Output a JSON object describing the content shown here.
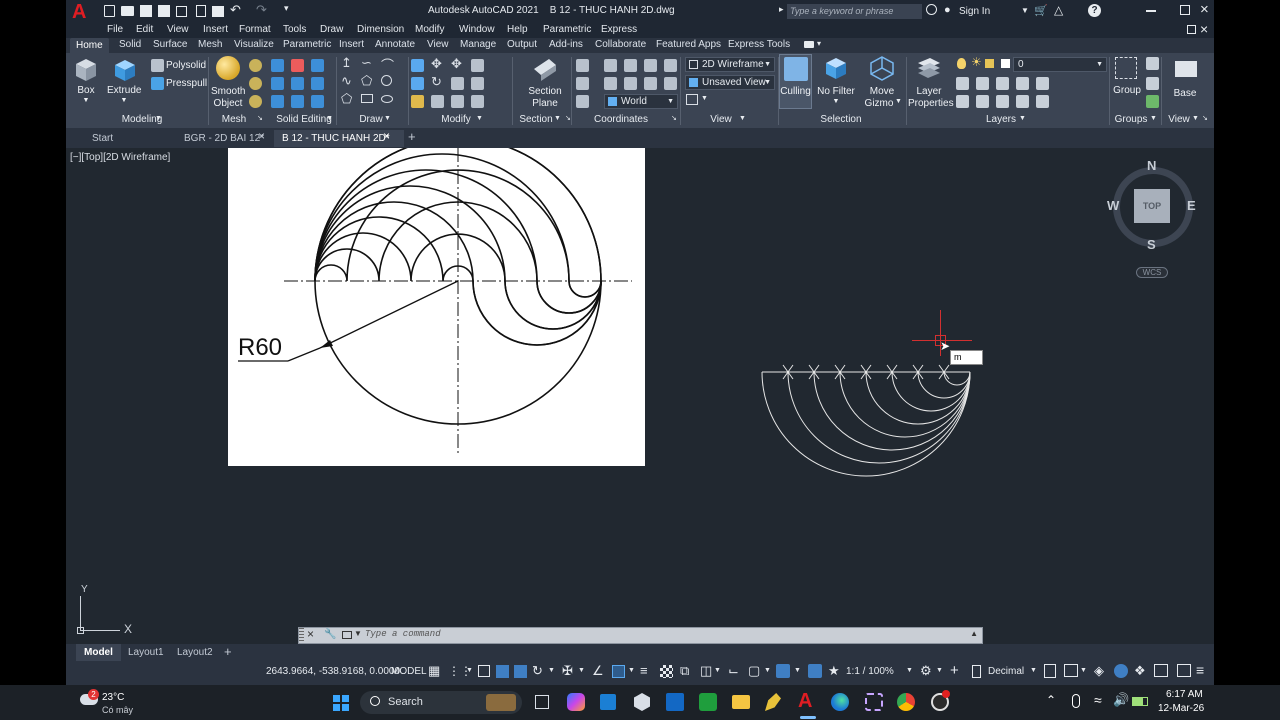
{
  "title_bar": {
    "app_title": "Autodesk AutoCAD 2021",
    "doc_title": "B 12 - THUC HANH 2D.dwg",
    "search_placeholder": "Type a keyword or phrase",
    "sign_in": "Sign In"
  },
  "menu": [
    "File",
    "Edit",
    "View",
    "Insert",
    "Format",
    "Tools",
    "Draw",
    "Dimension",
    "Modify",
    "Window",
    "Help",
    "Parametric",
    "Express"
  ],
  "ribbon_tabs": [
    "Home",
    "Solid",
    "Surface",
    "Mesh",
    "Visualize",
    "Parametric",
    "Insert",
    "Annotate",
    "View",
    "Manage",
    "Output",
    "Add-ins",
    "Collaborate",
    "Featured Apps",
    "Express Tools"
  ],
  "ribbon": {
    "box": "Box",
    "extrude": "Extrude",
    "polysolid": "Polysolid",
    "presspull": "Presspull",
    "smooth_object_1": "Smooth",
    "smooth_object_2": "Object",
    "section_plane_1": "Section",
    "section_plane_2": "Plane",
    "visual_style": "2D Wireframe",
    "saved_view": "Unsaved View",
    "ucs": "World",
    "culling": "Culling",
    "no_filter": "No Filter",
    "move_gizmo_1": "Move",
    "move_gizmo_2": "Gizmo",
    "layer_properties_1": "Layer",
    "layer_properties_2": "Properties",
    "layer_current": "0",
    "group": "Group",
    "base": "Base",
    "panels": {
      "modeling": "Modeling",
      "mesh": "Mesh",
      "solid_editing": "Solid Editing",
      "draw": "Draw",
      "modify": "Modify",
      "section": "Section",
      "coordinates": "Coordinates",
      "view": "View",
      "selection": "Selection",
      "layers": "Layers",
      "groups": "Groups",
      "view2": "View"
    }
  },
  "doc_tabs": [
    "Start",
    "BGR - 2D BAI 12*",
    "B 12 - THUC HANH 2D*"
  ],
  "viewport": {
    "label": "[−][Top][2D Wireframe]",
    "dimension_text": "R60",
    "input_value": "m",
    "viewcube": {
      "n": "N",
      "s": "S",
      "e": "E",
      "w": "W",
      "top": "TOP",
      "wcs": "WCS"
    },
    "ucs_x": "X",
    "ucs_y": "Y"
  },
  "command_line": {
    "placeholder": "Type a command"
  },
  "layout_tabs": [
    "Model",
    "Layout1",
    "Layout2"
  ],
  "status_bar": {
    "coords": "2643.9664, -538.9168, 0.0000",
    "model": "MODEL",
    "scale": "1:1 / 100%",
    "units": "Decimal"
  },
  "taskbar": {
    "temperature": "23°C",
    "weather": "Có mây",
    "weather_badge": "2",
    "search": "Search",
    "time": "6:17 AM",
    "date": "12-Mar-26"
  }
}
